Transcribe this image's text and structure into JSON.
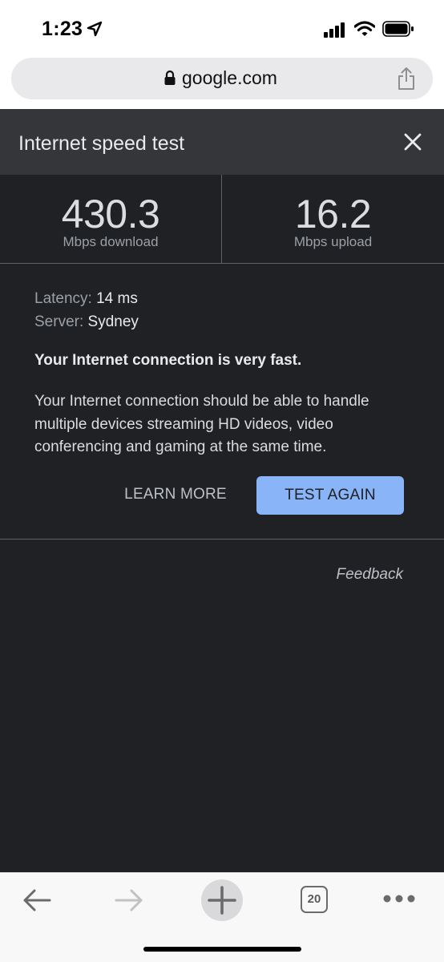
{
  "status_bar": {
    "time": "1:23",
    "icons": [
      "location-arrow-icon",
      "cellular-signal-icon",
      "wifi-icon",
      "battery-icon"
    ]
  },
  "url_bar": {
    "url": "google.com",
    "icons": [
      "lock-icon",
      "share-icon"
    ]
  },
  "speed_test": {
    "title": "Internet speed test",
    "download": {
      "value": "430.3",
      "unit": "Mbps download"
    },
    "upload": {
      "value": "16.2",
      "unit": "Mbps upload"
    },
    "latency": {
      "label": "Latency:",
      "value": "14 ms"
    },
    "server": {
      "label": "Server:",
      "value": "Sydney"
    },
    "summary": "Your Internet connection is very fast.",
    "description": "Your Internet connection should be able to handle multiple devices streaming HD videos, video conferencing and gaming at the same time.",
    "learn_more_label": "LEARN MORE",
    "test_again_label": "TEST AGAIN",
    "feedback_label": "Feedback"
  },
  "toolbar": {
    "tab_count": "20",
    "icons": [
      "back-arrow-icon",
      "forward-arrow-icon",
      "plus-icon",
      "tab-count-icon",
      "more-dots-icon"
    ]
  },
  "colors": {
    "page_background": "#202124",
    "header_background": "#35363a",
    "accent_button": "#8ab4f8",
    "text_primary": "#e8eaed",
    "text_secondary": "#9aa0a6"
  }
}
